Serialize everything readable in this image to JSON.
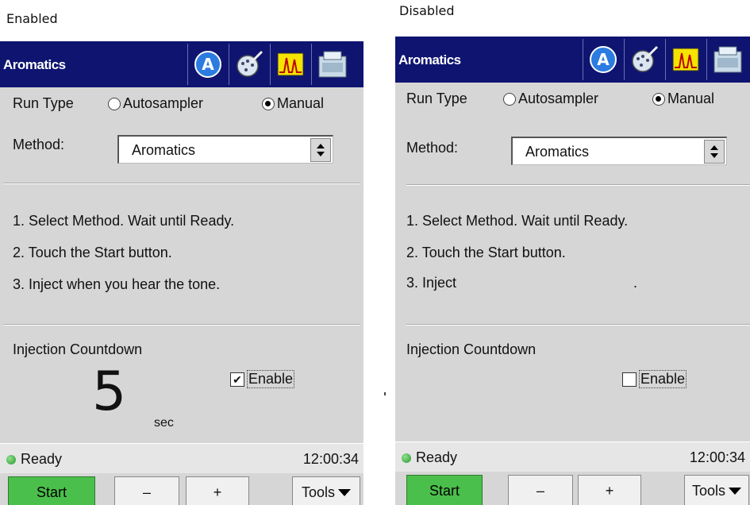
{
  "captions": {
    "left": "Enabled",
    "right": "Disabled"
  },
  "left": {
    "app_title": "Aromatics",
    "toolbar_icons": [
      "letter-a-icon",
      "syringe-plate-icon",
      "chromatogram-icon",
      "autosampler-icon"
    ],
    "run_type": {
      "label": "Run Type",
      "options": [
        "Autosampler",
        "Manual"
      ],
      "selected": "Manual"
    },
    "method": {
      "label": "Method:",
      "value": "Aromatics"
    },
    "steps": [
      "1. Select Method. Wait until Ready.",
      "2. Touch the Start button.",
      "3. Inject when you hear the tone."
    ],
    "countdown": {
      "label": "Injection Countdown",
      "value": "5",
      "unit": "sec",
      "enable_label": "Enable",
      "enabled": true
    },
    "status": {
      "text": "Ready",
      "time": "12:00:34"
    },
    "buttons": {
      "start": "Start",
      "minus": "–",
      "plus": "+",
      "tools": "Tools"
    }
  },
  "right": {
    "app_title": "Aromatics",
    "toolbar_icons": [
      "letter-a-icon",
      "syringe-plate-icon",
      "chromatogram-icon",
      "autosampler-icon"
    ],
    "run_type": {
      "label": "Run Type",
      "options": [
        "Autosampler",
        "Manual"
      ],
      "selected": "Manual"
    },
    "method": {
      "label": "Method:",
      "value": "Aromatics"
    },
    "steps": [
      "1. Select Method. Wait until Ready.",
      "2. Touch the Start button.",
      "3. Inject",
      "."
    ],
    "countdown": {
      "label": "Injection Countdown",
      "enable_label": "Enable",
      "enabled": false
    },
    "status": {
      "text": "Ready",
      "time": "12:00:34"
    },
    "buttons": {
      "start": "Start",
      "minus": "–",
      "plus": "+",
      "tools": "Tools"
    }
  },
  "colors": {
    "titlebar": "#0e1470",
    "start_button": "#4bbf4b",
    "panel": "#d6d6d6",
    "ready_dot": "#2a9a2a"
  }
}
